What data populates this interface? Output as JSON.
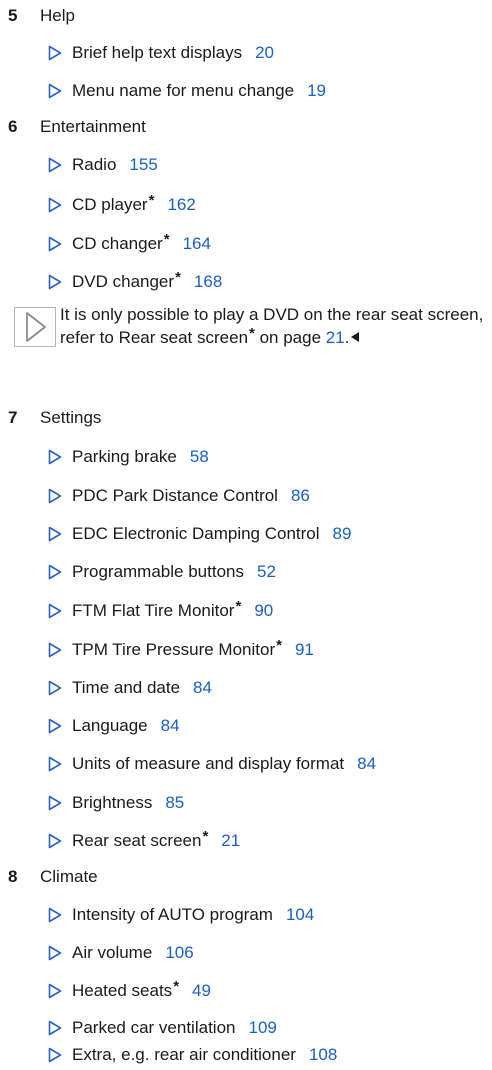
{
  "sections": [
    {
      "number": "5",
      "title": "Help",
      "items": [
        {
          "label": "Brief help text displays",
          "page": "20"
        },
        {
          "label": "Menu name for menu change",
          "page": "19"
        }
      ]
    },
    {
      "number": "6",
      "title": "Entertainment",
      "items": [
        {
          "label": "Radio",
          "page": "155"
        },
        {
          "label": "CD player",
          "star": "*",
          "page": "162"
        },
        {
          "label": "CD changer",
          "star": "*",
          "page": "164"
        },
        {
          "label": "DVD changer",
          "star": "*",
          "page": "168"
        }
      ],
      "note": {
        "text": "It is only possible to play a DVD on the rear seat screen, refer to Rear seat screen",
        "star": "*",
        "middle": " on page ",
        "page": "21",
        "end": "."
      }
    },
    {
      "number": "7",
      "title": "Settings",
      "items": [
        {
          "label": "Parking brake",
          "page": "58"
        },
        {
          "label": "PDC Park Distance Control",
          "page": "86"
        },
        {
          "label": "EDC Electronic Damping Control",
          "page": "89"
        },
        {
          "label": "Programmable buttons",
          "page": "52"
        },
        {
          "label": "FTM Flat Tire Monitor",
          "star": "*",
          "page": "90"
        },
        {
          "label": "TPM Tire Pressure Monitor",
          "star": "*",
          "page": "91"
        },
        {
          "label": "Time and date",
          "page": "84"
        },
        {
          "label": "Language",
          "page": "84"
        },
        {
          "label": "Units of measure and display format",
          "page": "84"
        },
        {
          "label": "Brightness",
          "page": "85"
        },
        {
          "label": "Rear seat screen",
          "star": "*",
          "page": "21"
        }
      ]
    },
    {
      "number": "8",
      "title": "Climate",
      "items": [
        {
          "label": "Intensity of AUTO program",
          "page": "104"
        },
        {
          "label": "Air volume",
          "page": "106"
        },
        {
          "label": "Heated seats",
          "star": "*",
          "page": "49"
        },
        {
          "label": "Parked car ventilation",
          "page": "109"
        },
        {
          "label": "Extra, e.g. rear air conditioner",
          "page": "108"
        }
      ]
    }
  ],
  "colors": {
    "link": "#1a5fc4",
    "bullet": "#2a63c4",
    "text": "#1a1a1a"
  },
  "icons": {
    "bullet": "triangle-right-outline-icon",
    "note": "note-triangle-icon",
    "end_mark": "end-of-note-icon"
  }
}
